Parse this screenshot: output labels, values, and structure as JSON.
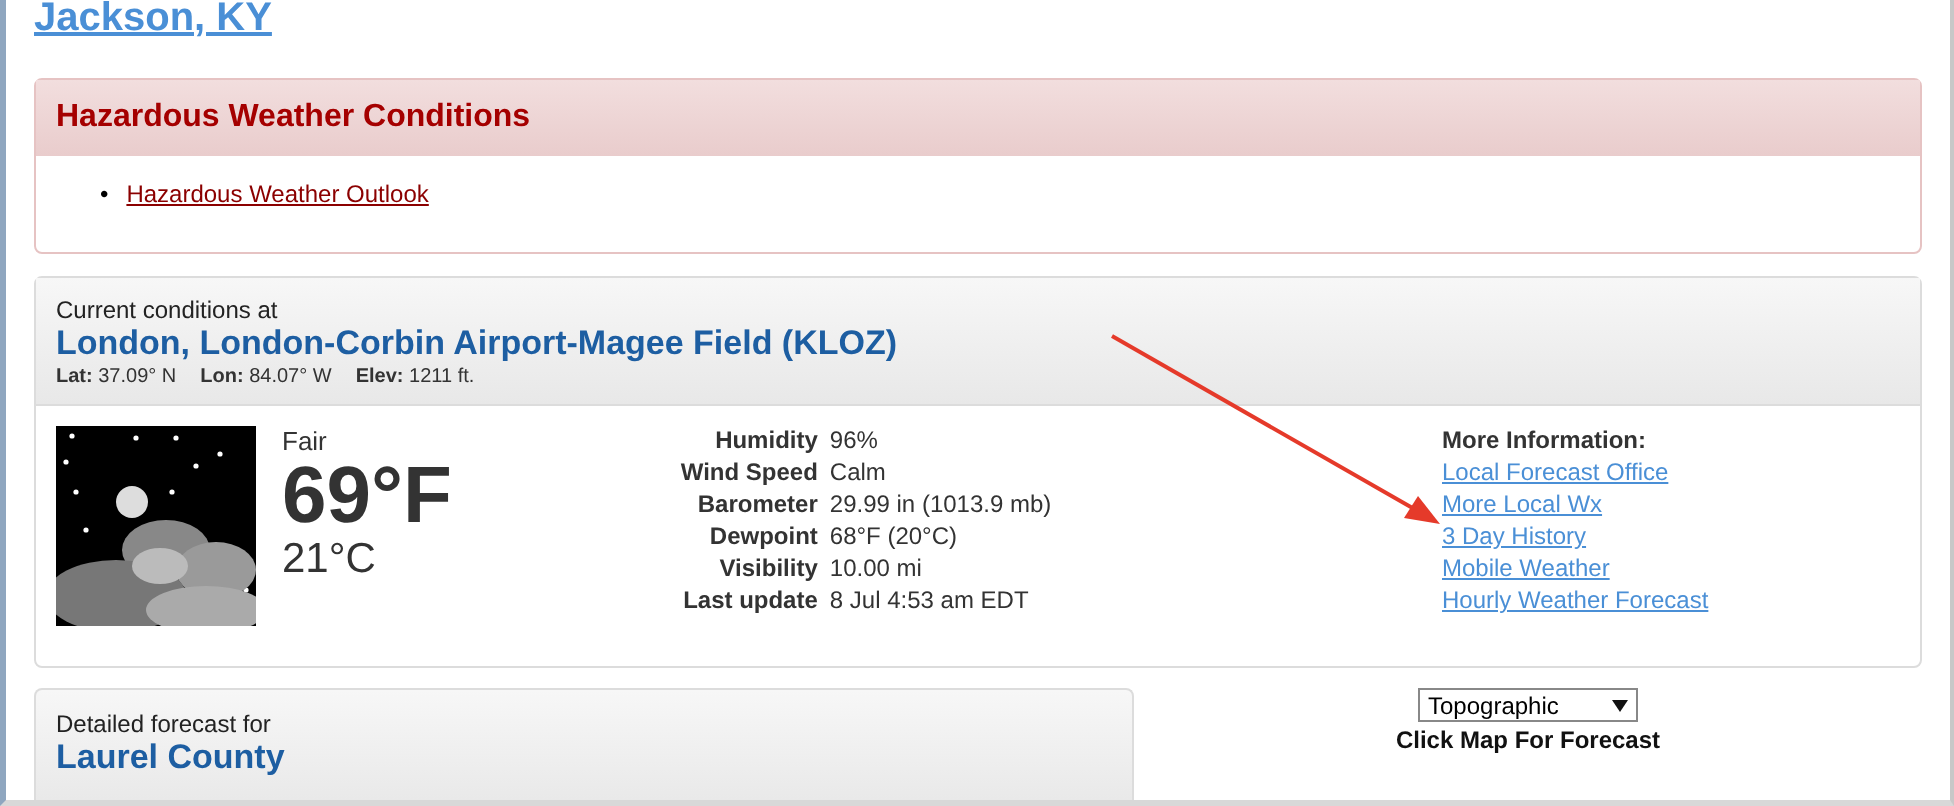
{
  "location": {
    "title": "Jackson, KY"
  },
  "hazards": {
    "title": "Hazardous Weather Conditions",
    "bullet": "•",
    "items": [
      "Hazardous Weather Outlook"
    ]
  },
  "current": {
    "intro": "Current conditions at",
    "station": "London, London-Corbin Airport-Magee Field (KLOZ)",
    "coords": [
      {
        "label": "Lat:",
        "value": "37.09° N"
      },
      {
        "label": "Lon:",
        "value": "84.07° W"
      },
      {
        "label": "Elev:",
        "value": "1211 ft."
      }
    ],
    "summary": "Fair",
    "temp_f": "69°F",
    "temp_c": "21°C",
    "details": [
      {
        "label": "Humidity",
        "value": "96%"
      },
      {
        "label": "Wind Speed",
        "value": "Calm"
      },
      {
        "label": "Barometer",
        "value": "29.99 in (1013.9 mb)"
      },
      {
        "label": "Dewpoint",
        "value": "68°F (20°C)"
      },
      {
        "label": "Visibility",
        "value": "10.00 mi"
      },
      {
        "label": "Last update",
        "value": "8 Jul 4:53 am EDT"
      }
    ],
    "more_info": {
      "title": "More Information:",
      "links": [
        "Local Forecast Office",
        "More Local Wx",
        "3 Day History",
        "Mobile Weather",
        "Hourly Weather Forecast"
      ]
    }
  },
  "forecast": {
    "intro": "Detailed forecast for",
    "area": "Laurel County"
  },
  "map": {
    "select": "Topographic",
    "caption": "Click Map For Forecast"
  }
}
